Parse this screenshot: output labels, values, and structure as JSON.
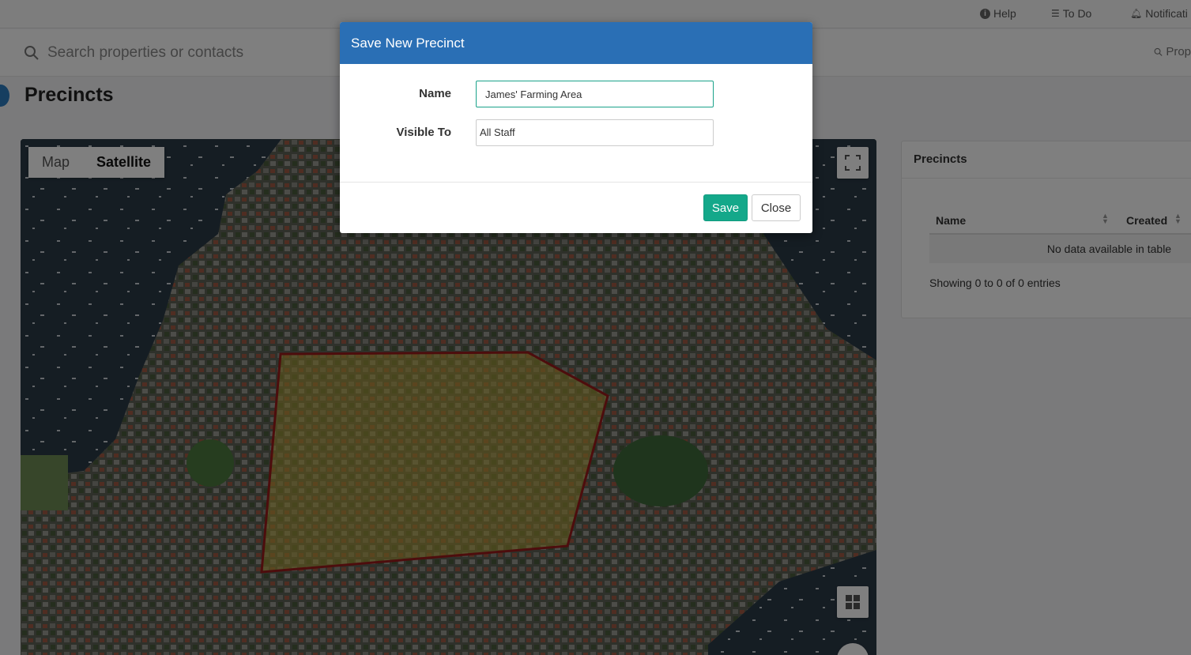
{
  "topnav": {
    "help_label": "Help",
    "todo_label": "To Do",
    "notifications_label": "Notificati"
  },
  "search": {
    "placeholder": "Search properties or contacts",
    "properties_link": "Prop"
  },
  "page": {
    "title": "Precincts"
  },
  "map": {
    "type_options": [
      "Map",
      "Satellite"
    ],
    "active_type": "Satellite",
    "polygon_stroke": "#9b1b1b",
    "polygon_fill": "#c9b43a"
  },
  "side_panel": {
    "title": "Precincts",
    "columns": [
      "Name",
      "Created"
    ],
    "empty_message": "No data available in table",
    "info": "Showing 0 to 0 of 0 entries"
  },
  "modal": {
    "title": "Save New Precinct",
    "name_label": "Name",
    "name_value": "James' Farming Area",
    "visible_label": "Visible To",
    "visible_value": "All Staff",
    "save_label": "Save",
    "close_label": "Close"
  },
  "colors": {
    "header_blue": "#2a6fb5",
    "save_green": "#14a88a",
    "focus_border": "#1aa28a"
  }
}
